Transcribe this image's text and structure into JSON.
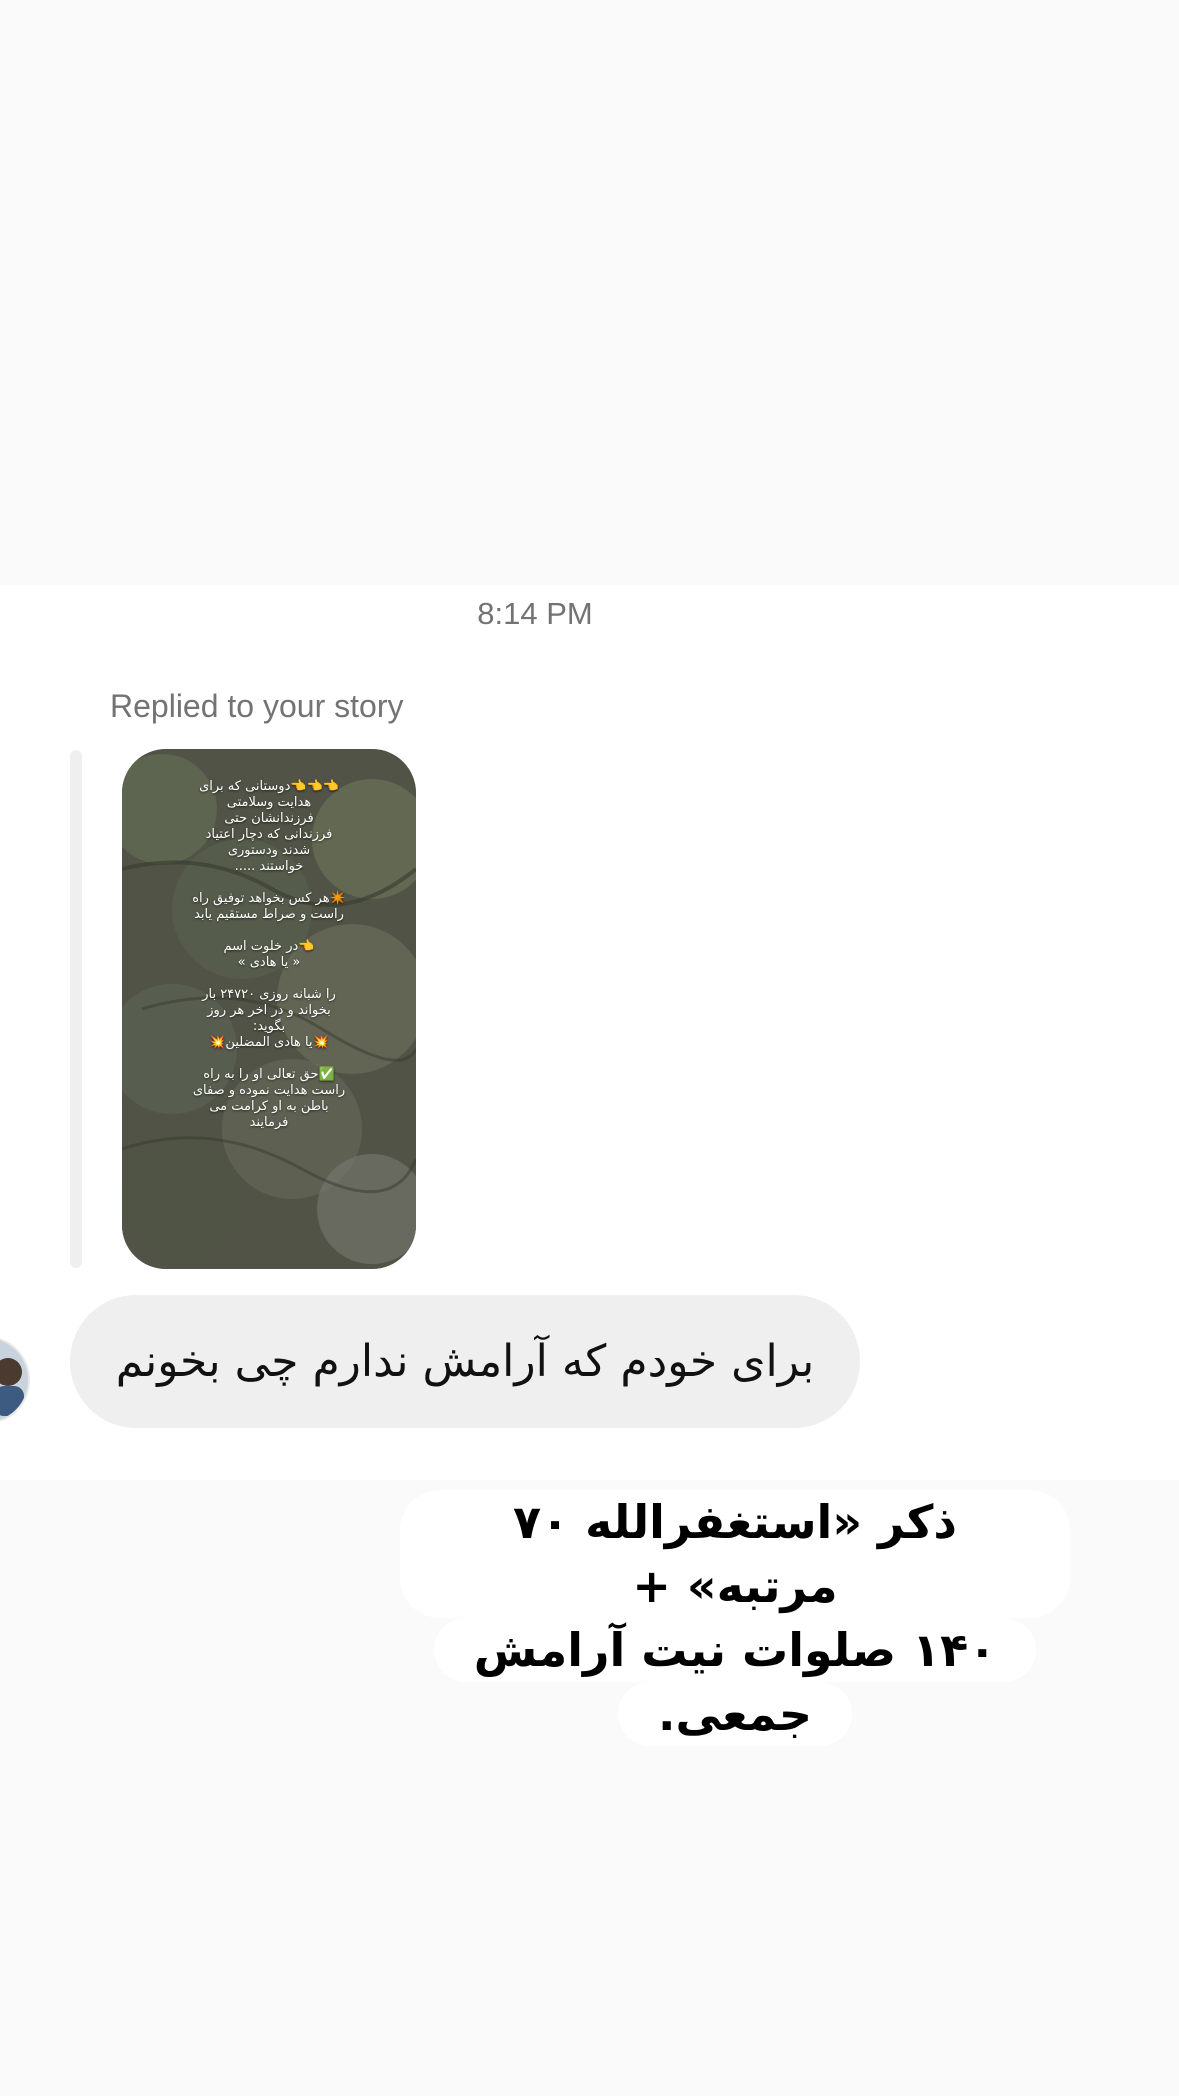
{
  "thread": {
    "timestamp": "8:14 PM",
    "reply_label": "Replied to your story",
    "story_caption": "👈👈👈دوستانی که برای\nهدایت وسلامتی\nفرزندانشان حتی\nفرزندانی که دچار اعتیاد\nشدند ودستوری\nخواستند .....\n\n✴️هر کس بخواهد توفیق راه\nراست و صراط مستقیم یابد\n\n👈در خلوت اسم\n« یا هادی »\n\nرا شبانه روزی ۲۴۷۲۰ بار\nبخواند و در اخر هر روز\nبگوید:\n💥یا هادی المضلین💥\n\n✅حق تعالی او را به راه\nراست هدایت نموده و صفای\nباطن به او کرامت می\nفرمایند",
    "message": "برای خودم که آرامش ندارم چی بخونم",
    "avatar_icon": "profile-avatar-icon"
  },
  "reply_sticker": {
    "lines": [
      "ذکر «استغفرالله ۷۰ مرتبه» +",
      "۱۴۰ صلوات نیت آرامش",
      "جمعی."
    ]
  },
  "colors": {
    "background": "#fafafa",
    "bubble": "#efefef",
    "muted_text": "#737373"
  }
}
